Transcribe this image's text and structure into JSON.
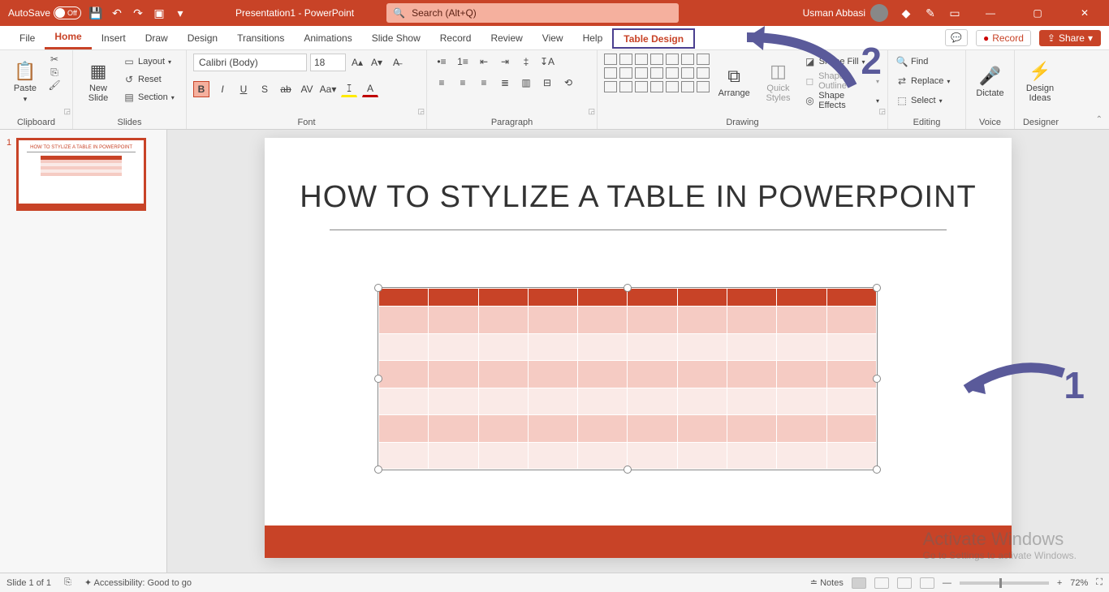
{
  "titlebar": {
    "autosave_label": "AutoSave",
    "autosave_state": "Off",
    "doc_title": "Presentation1 - PowerPoint",
    "search_placeholder": "Search (Alt+Q)",
    "user_name": "Usman Abbasi"
  },
  "tabs": {
    "file": "File",
    "home": "Home",
    "insert": "Insert",
    "draw": "Draw",
    "design": "Design",
    "transitions": "Transitions",
    "animations": "Animations",
    "slideshow": "Slide Show",
    "record": "Record",
    "review": "Review",
    "view": "View",
    "help": "Help",
    "table_design": "Table Design",
    "record_btn": "Record",
    "share_btn": "Share"
  },
  "ribbon": {
    "clipboard": {
      "label": "Clipboard",
      "paste": "Paste"
    },
    "slides": {
      "label": "Slides",
      "new_slide": "New\nSlide",
      "layout": "Layout",
      "reset": "Reset",
      "section": "Section"
    },
    "font": {
      "label": "Font",
      "name": "Calibri (Body)",
      "size": "18"
    },
    "paragraph": {
      "label": "Paragraph"
    },
    "drawing": {
      "label": "Drawing",
      "arrange": "Arrange",
      "quick_styles": "Quick\nStyles",
      "shape_fill": "Shape Fill",
      "shape_outline": "Shape Outline",
      "shape_effects": "Shape Effects"
    },
    "editing": {
      "label": "Editing",
      "find": "Find",
      "replace": "Replace",
      "select": "Select"
    },
    "voice": {
      "label": "Voice",
      "dictate": "Dictate"
    },
    "designer": {
      "label": "Designer",
      "design_ideas": "Design\nIdeas"
    }
  },
  "slide": {
    "title": "HOW TO STYLIZE A TABLE IN POWERPOINT",
    "thumb_number": "1"
  },
  "annotations": {
    "one": "1",
    "two": "2"
  },
  "watermark": {
    "line1": "Activate Windows",
    "line2": "Go to Settings to activate Windows."
  },
  "statusbar": {
    "slide_info": "Slide 1 of 1",
    "accessibility": "Accessibility: Good to go",
    "notes": "Notes",
    "zoom": "72%"
  }
}
